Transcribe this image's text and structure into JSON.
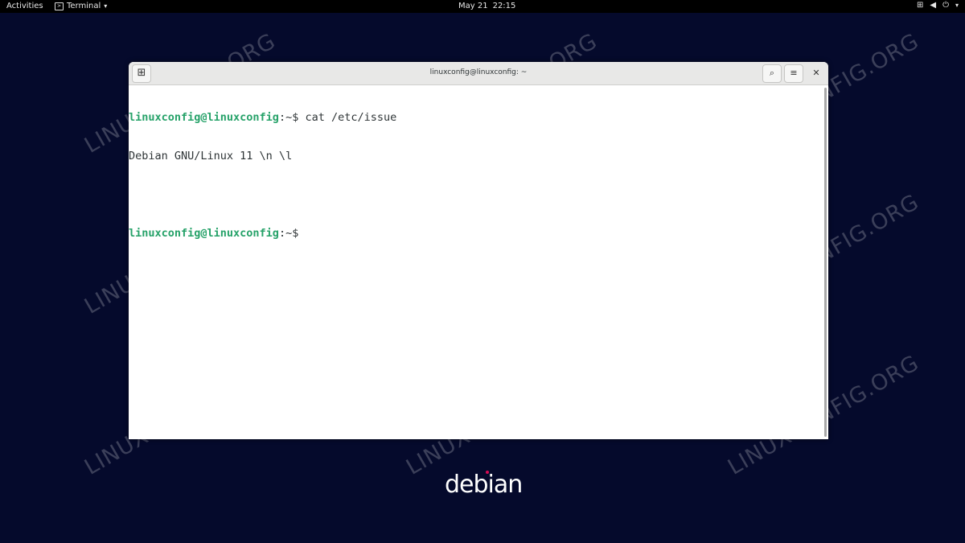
{
  "topbar": {
    "activities": "Activities",
    "app_name": "Terminal",
    "date": "May 21",
    "time": "22:15"
  },
  "desktop": {
    "logo_text": "debian",
    "watermark": "LINUXCONFIG.ORG"
  },
  "window": {
    "title": "linuxconfig@linuxconfig: ~",
    "lines": [
      {
        "user": "linuxconfig@linuxconfig",
        "path": ":~",
        "cmd": "$ cat /etc/issue"
      },
      {
        "output": "Debian GNU/Linux 11 \\n \\l"
      },
      {
        "output": ""
      },
      {
        "user": "linuxconfig@linuxconfig",
        "path": ":~",
        "cmd": "$"
      }
    ]
  },
  "colors": {
    "desktop_bg": "#050a2c",
    "prompt_green": "#26a269",
    "debian_red": "#d70a53"
  }
}
